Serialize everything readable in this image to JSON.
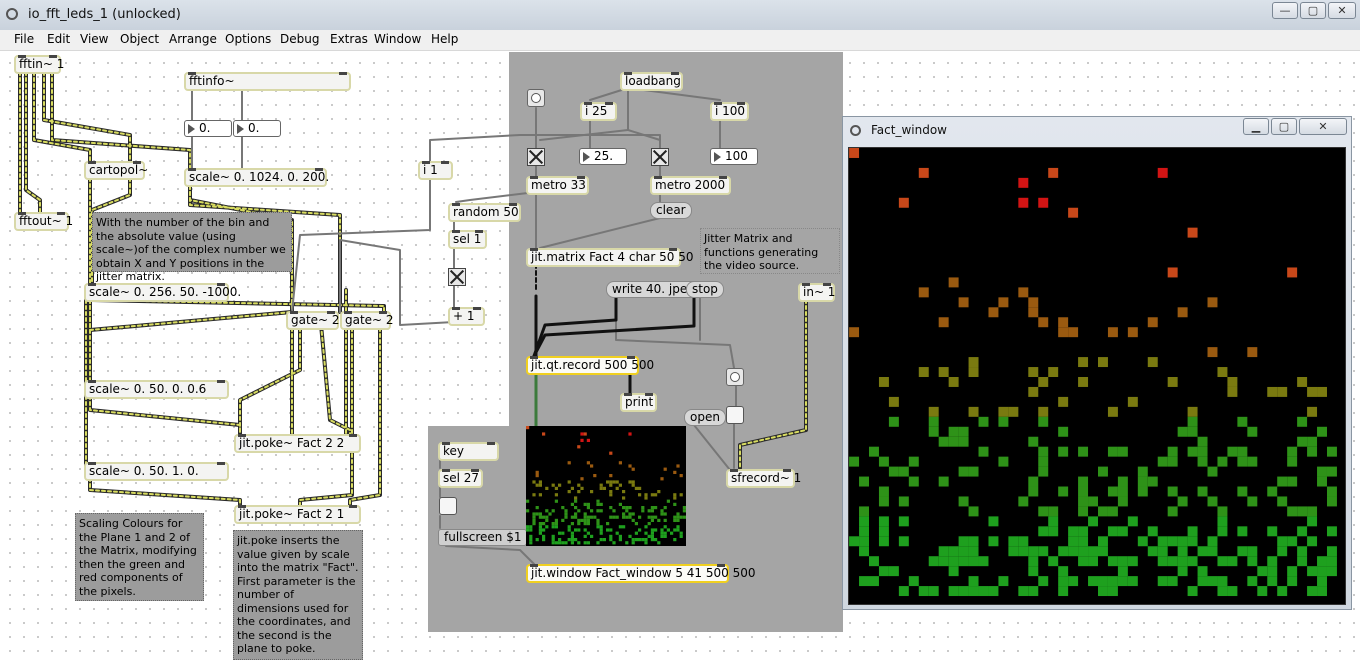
{
  "window": {
    "title": "io_fft_leds_1 (unlocked)",
    "controls": [
      "—",
      "▢",
      "✕"
    ]
  },
  "menu": [
    "File",
    "Edit",
    "View",
    "Object",
    "Arrange",
    "Options",
    "Debug",
    "Extras",
    "Window",
    "Help"
  ],
  "objects": {
    "fftin": "fftin~ 1",
    "fftinfo": "fftinfo~",
    "fftout": "fftout~ 1",
    "cartopol": "cartopol~",
    "scale_1024": "scale~ 0. 1024. 0. 200.",
    "scale_256": "scale~ 0. 256. 50. -1000.",
    "scale_50_06": "scale~ 0. 50. 0. 0.6",
    "scale_50_1": "scale~ 0. 50. 1. 0.",
    "gate_a": "gate~ 2",
    "gate_b": "gate~ 2",
    "poke_2_2": "jit.poke~ Fact 2 2",
    "poke_2_1": "jit.poke~ Fact 2 1",
    "i1": "i 1",
    "random": "random 50",
    "sel1": "sel 1",
    "plus1": "+ 1",
    "loadbang": "loadbang",
    "i25": "i 25",
    "i100": "i 100",
    "metro33": "metro 33",
    "metro2000": "metro 2000",
    "jit_matrix": "jit.matrix Fact 4 char 50 50",
    "jit_qt_record": "jit.qt.record 500 500",
    "print": "print",
    "in1": "in~ 1",
    "sfrecord": "sfrecord~ 1",
    "key": "key",
    "sel27": "sel 27",
    "jit_window": "jit.window Fact_window 5 41 500 500"
  },
  "numbers": {
    "fftinfo_out_a": "0.",
    "fftinfo_out_b": "0.",
    "n25": "25.",
    "n100": "100"
  },
  "messages": {
    "clear": "clear",
    "write": "write 40. jpeg",
    "stop": "stop",
    "open": "open",
    "fullscreen": "fullscreen $1"
  },
  "comments": {
    "xy_positions": "With the number of the bin and the absolute value (using scale~)of the complex number we obtain X and Y positions in the jitter matrix.",
    "jitter_matrix": "Jitter Matrix and functions generating the video source.",
    "scaling_colours": "Scaling Colours for the Plane 1 and 2 of the Matrix, modifying then the green and red components of the pixels.",
    "jit_poke": "jit.poke inserts the value given by scale into the matrix \"Fact\". First parameter is the number of dimensions used for the coordinates, and the second is the plane to poke."
  },
  "fact_window": {
    "title": "Fact_window",
    "controls": [
      "▁",
      "▢",
      "✕"
    ]
  },
  "colors": {
    "red": "#d21414",
    "orange": "#c8481a",
    "brown": "#9a5a10",
    "olive": "#7a7a10",
    "green": "#2e9218",
    "green_bright": "#1ea01e"
  }
}
